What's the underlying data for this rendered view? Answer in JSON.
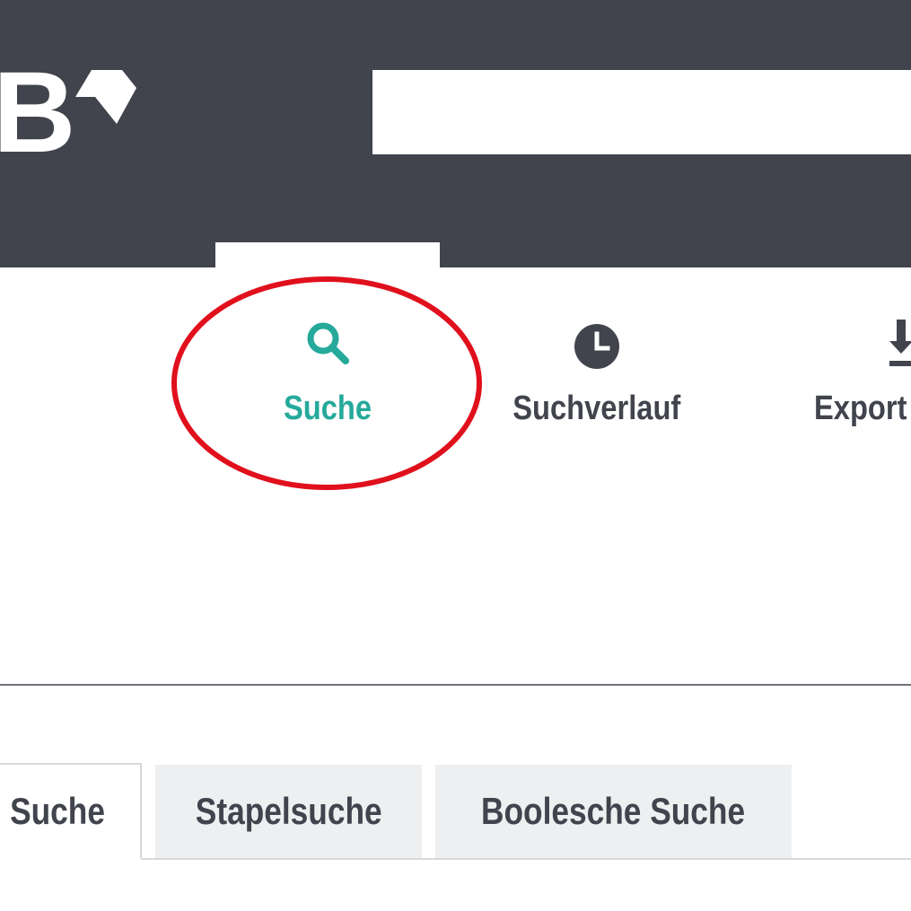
{
  "header": {
    "logo_letter": "B",
    "search_value": "",
    "background": "#41444d"
  },
  "nav": {
    "items": [
      {
        "label": "Suche",
        "icon": "search-icon",
        "active": true
      },
      {
        "label": "Suchverlauf",
        "icon": "clock-icon",
        "active": false
      },
      {
        "label": "Export",
        "icon": "download-icon",
        "active": false
      }
    ]
  },
  "tabs": [
    {
      "label": "Suche",
      "active": true
    },
    {
      "label": "Stapelsuche",
      "active": false
    },
    {
      "label": "Boolesche Suche",
      "active": false
    }
  ],
  "colors": {
    "accent": "#25a99a",
    "text": "#41444d",
    "highlight": "#e0101c",
    "tab_inactive": "#eeeff1"
  }
}
